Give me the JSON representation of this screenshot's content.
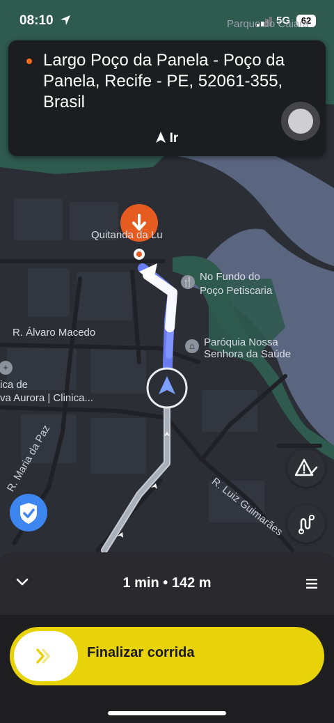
{
  "status_bar": {
    "time": "08:10",
    "network": "5G",
    "battery": "62"
  },
  "map": {
    "park_label": "Parque do Caiara",
    "destination_marker": "Quitanda da Lu",
    "poi_restaurant": [
      "No Fundo do",
      "Poço Petiscaria"
    ],
    "poi_church": [
      "Paróquia Nossa",
      "Senhora da Saúde"
    ],
    "street_alvaro": "R. Álvaro Macedo",
    "clinic_label": [
      "ica de",
      "va Aurora | Clinica..."
    ],
    "street_paz": "R. Maria da Paz",
    "street_luiz": "R. Luiz Guimarães"
  },
  "destination": {
    "address": "Largo Poço da Panela - Poço da Panela, Recife - PE, 52061-355, Brasil",
    "go_label": "Ir"
  },
  "trip": {
    "eta": "1 min • 142 m"
  },
  "finish": {
    "label": "Finalizar corrida"
  },
  "icons": {
    "location": "location-arrow-icon",
    "chevron": "chevron-down-icon",
    "menu": "menu-icon",
    "shield": "shield-check-icon",
    "report": "warning-report-icon",
    "route": "route-options-icon",
    "slider": "double-chevron-right-icon"
  },
  "colors": {
    "accent_yellow": "#e8d209",
    "destination_orange": "#e65b20",
    "route_blue": "#6a7cf2",
    "shield_blue": "#3d86ef"
  }
}
